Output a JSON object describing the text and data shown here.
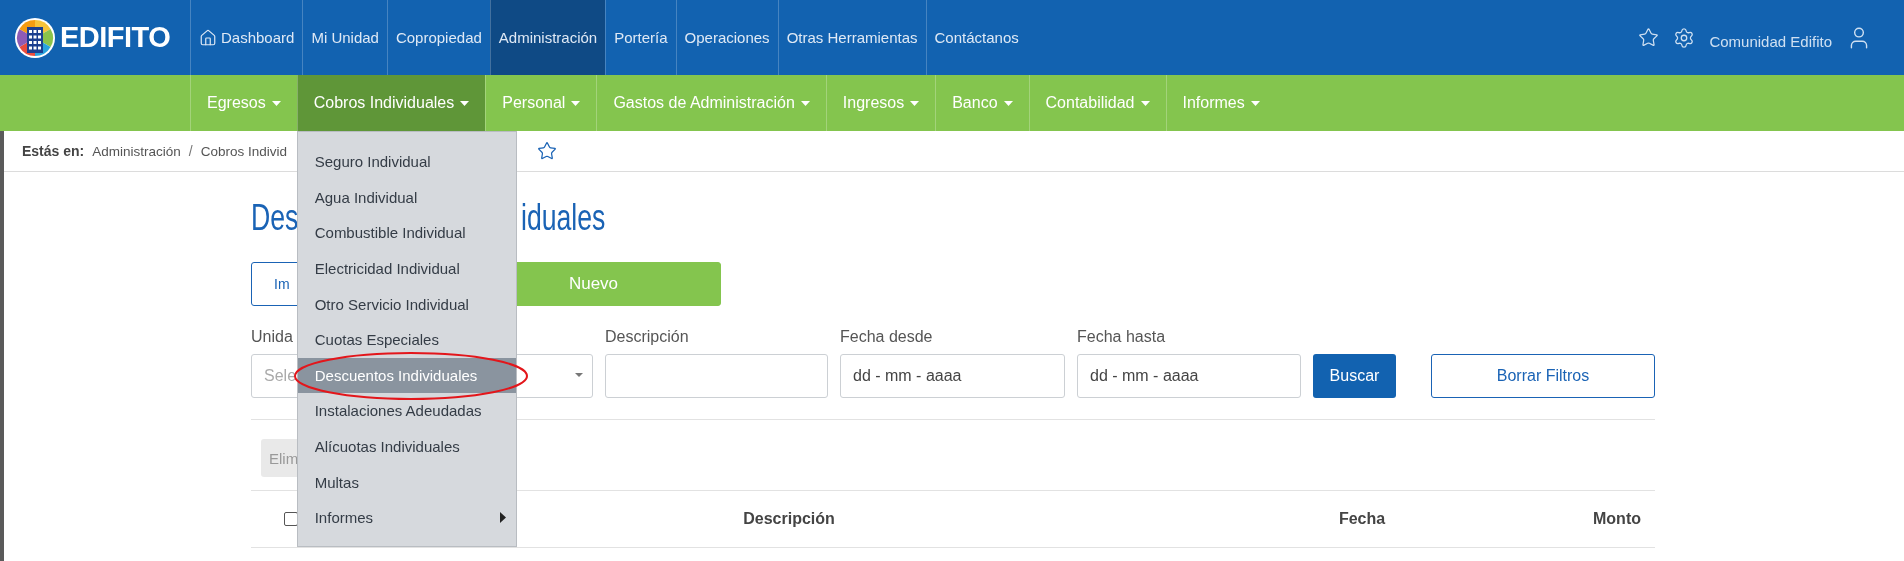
{
  "brand": {
    "name": "EDIFITO"
  },
  "top_nav": [
    {
      "label": "Dashboard",
      "selected": false
    },
    {
      "label": "Mi Unidad",
      "selected": false
    },
    {
      "label": "Copropiedad",
      "selected": false
    },
    {
      "label": "Administración",
      "selected": true
    },
    {
      "label": "Portería",
      "selected": false
    },
    {
      "label": "Operaciones",
      "selected": false
    },
    {
      "label": "Otras Herramientas",
      "selected": false
    },
    {
      "label": "Contáctanos",
      "selected": false
    }
  ],
  "user_menu": {
    "name": "Comunidad Edifito"
  },
  "sub_nav": [
    {
      "label": "Egresos",
      "selected": false
    },
    {
      "label": "Cobros Individuales",
      "selected": true
    },
    {
      "label": "Personal",
      "selected": false
    },
    {
      "label": "Gastos de Administración",
      "selected": false
    },
    {
      "label": "Ingresos",
      "selected": false
    },
    {
      "label": "Banco",
      "selected": false
    },
    {
      "label": "Contabilidad",
      "selected": false
    },
    {
      "label": "Informes",
      "selected": false
    }
  ],
  "dropdown": {
    "items": [
      {
        "label": "Seguro Individual",
        "kind": "link",
        "selected": false
      },
      {
        "label": "Agua Individual",
        "kind": "link",
        "selected": false
      },
      {
        "label": "Combustible Individual",
        "kind": "link",
        "selected": false
      },
      {
        "label": "Electricidad Individual",
        "kind": "link",
        "selected": false
      },
      {
        "label": "Otro Servicio Individual",
        "kind": "link",
        "selected": false
      },
      {
        "label": "Cuotas Especiales",
        "kind": "link",
        "selected": false
      },
      {
        "label": "Descuentos Individuales",
        "kind": "link",
        "selected": true
      },
      {
        "label": "Instalaciones Adeudadas",
        "kind": "link",
        "selected": false
      },
      {
        "label": "Alícuotas Individuales",
        "kind": "link",
        "selected": false
      },
      {
        "label": "Multas",
        "kind": "link",
        "selected": false
      },
      {
        "label": "Informes",
        "kind": "submenu",
        "selected": false
      }
    ]
  },
  "breadcrumb": {
    "prefix": "Estás en:",
    "separator": "/",
    "items": [
      "Administración",
      "Cobros Individ"
    ]
  },
  "page": {
    "title_start": "Des",
    "title_end": "iduales",
    "actions": [
      {
        "label": "Im",
        "kind": "outline"
      },
      {
        "label": "Nuevo",
        "kind": "primary"
      }
    ],
    "filters": [
      {
        "label": "Unida",
        "kind": "select",
        "placeholder": "Sele"
      },
      {
        "label": "Descripción",
        "kind": "text"
      },
      {
        "label": "Fecha desde",
        "kind": "date",
        "placeholder": "dd - mm - aaaa"
      },
      {
        "label": "Fecha hasta",
        "kind": "date",
        "placeholder": "dd - mm - aaaa"
      }
    ],
    "search_button": "Buscar",
    "clear_button": "Borrar Filtros",
    "bulk_button": "Elim",
    "table": {
      "select_all": {
        "checked": false
      },
      "columns": [
        "Descripción",
        "Fecha",
        "Monto"
      ]
    }
  }
}
